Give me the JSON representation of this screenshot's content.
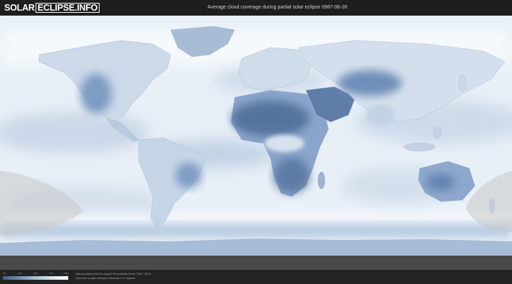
{
  "header": {
    "logo_left": "SOLAR",
    "logo_right": "ECLIPSE.INFO",
    "title": "Average cloud coverage during partial solar eclipse 0987-06-28"
  },
  "map": {
    "type": "world-cloud-coverage",
    "projection": "equirectangular",
    "color_scale": [
      "#3d5f91",
      "#6f8fb8",
      "#a8bfd8",
      "#dce6f1",
      "#ffffff"
    ],
    "eclipse_shadow_color": "#c9c9c9",
    "ocean_color": "#eef3f9"
  },
  "legend": {
    "ticks": [
      "0%",
      "25%",
      "50%",
      "75%",
      "100%"
    ]
  },
  "footer": {
    "credit_line1": "Data provided by NASA's Aqua & Terra satellite (Years: 2000 - 2019)",
    "credit_line2": "https://neo.sci.gsfc.nasa.gov | Resolution: 0.1 degrees"
  }
}
